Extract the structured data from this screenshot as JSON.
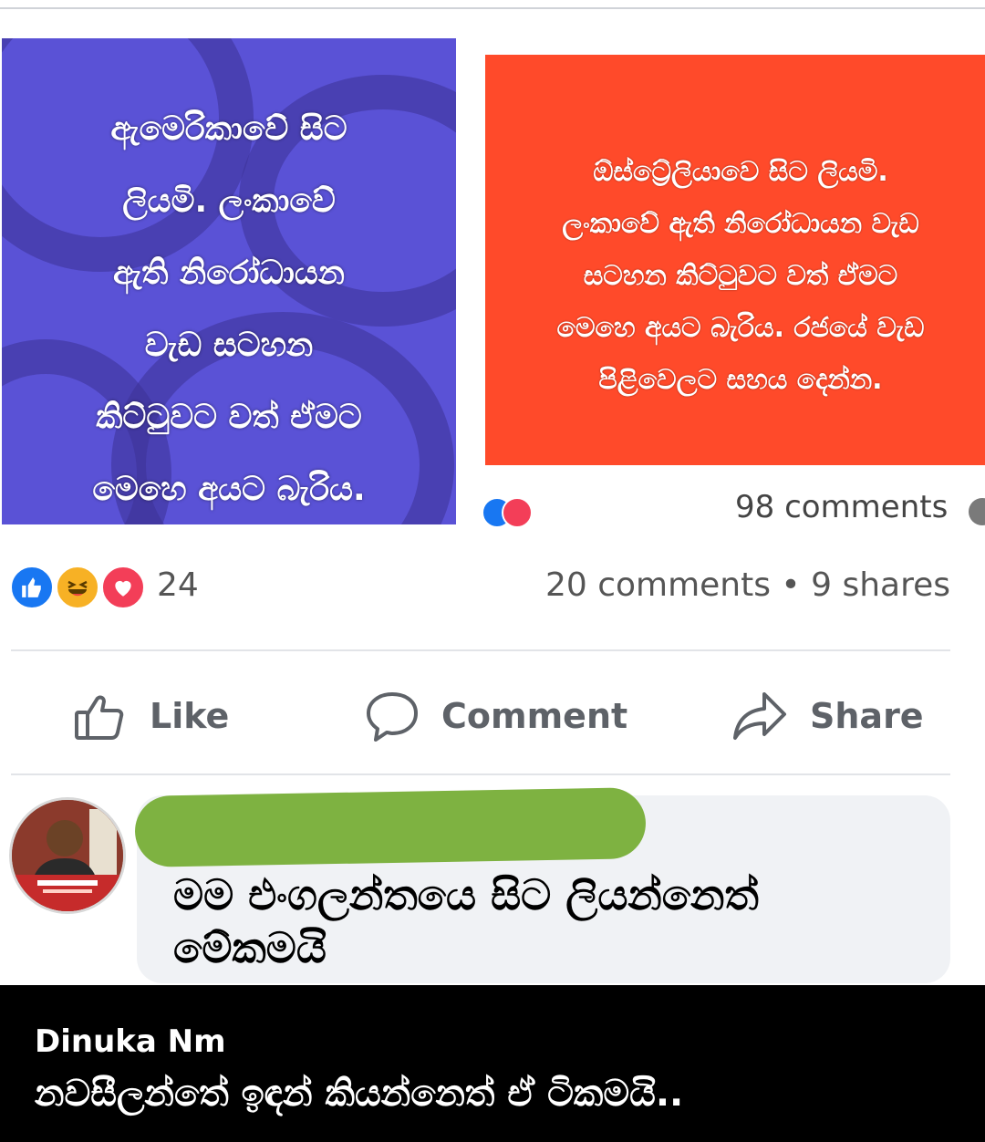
{
  "post_images": {
    "left_image_text": "ඇමෙරිකාවේ සිට\nලියමි. ලංකාවේ\nඇති නිරෝධායන\nවැඩ සටහන\nකිට්ටුවට වත් ඒමට\nමෙහෙ අයට බැරිය.",
    "right_image_text": "ඕස්ට්‍රේලියාවෙ සිට ලියමි.\nලංකාවේ ඇති නිරෝධායන වැඩ\nසටහන කිට්ටුවට වත් ඒමට\nමෙහෙ අයට බැරිය. රජයේ වැඩ\nපිළිවෙලට සහය දෙන්න.",
    "right_post_comments": "98 comments",
    "colors": {
      "left_bg": "#5a52d6",
      "right_bg": "#ff4a2a"
    }
  },
  "reactions": {
    "icons": [
      "like-icon",
      "haha-icon",
      "love-icon"
    ],
    "count": "24",
    "comments_shares": "20 comments • 9 shares"
  },
  "actions": {
    "like_label": "Like",
    "comment_label": "Comment",
    "share_label": "Share"
  },
  "comment": {
    "text": "මම එංගලන්තයෙ සිට ලියන්නෙත් මේකමයි"
  },
  "caption": {
    "name": "Dinuka Nm",
    "text": "නවසීලන්තේ ඉඳන් කියන්නෙත් ඒ ටිකමයි.."
  }
}
